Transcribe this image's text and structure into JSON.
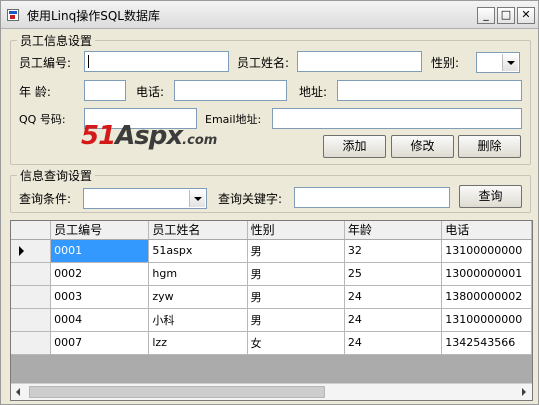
{
  "window": {
    "title": "使用Linq操作SQL数据库",
    "min_symbol": "_",
    "max_symbol": "□",
    "close_symbol": "✕"
  },
  "employee_group": {
    "legend": "员工信息设置",
    "emp_no_label": "员工编号:",
    "emp_name_label": "员工姓名:",
    "gender_label": "性别:",
    "age_label": "年    龄:",
    "phone_label": "电话:",
    "address_label": "地址:",
    "qq_label": "QQ  号码:",
    "email_label": "Email地址:",
    "emp_no_value": "",
    "emp_name_value": "",
    "gender_value": "",
    "age_value": "",
    "phone_value": "",
    "address_value": "",
    "qq_value": "",
    "email_value": "",
    "add_button": "添加",
    "edit_button": "修改",
    "delete_button": "删除"
  },
  "watermark": {
    "part1": "51",
    "part2": "Aspx",
    "part3": ".com"
  },
  "query_group": {
    "legend": "信息查询设置",
    "condition_label": "查询条件:",
    "condition_value": "",
    "keyword_label": "查询关键字:",
    "keyword_value": "",
    "query_button": "查询"
  },
  "grid": {
    "columns": [
      "员工编号",
      "员工姓名",
      "性别",
      "年龄",
      "电话"
    ],
    "rows": [
      [
        "0001",
        "51aspx",
        "男",
        "32",
        "13100000000"
      ],
      [
        "0002",
        "hgm",
        "男",
        "25",
        "13000000001"
      ],
      [
        "0003",
        "zyw",
        "男",
        "24",
        "13800000002"
      ],
      [
        "0004",
        "小科",
        "男",
        "24",
        "13100000000"
      ],
      [
        "0007",
        "lzz",
        "女",
        "24",
        "1342543566"
      ]
    ]
  },
  "colors": {
    "selection": "#3399ff",
    "watermark_red": "#d41919",
    "watermark_gray": "#3c3c3c"
  }
}
